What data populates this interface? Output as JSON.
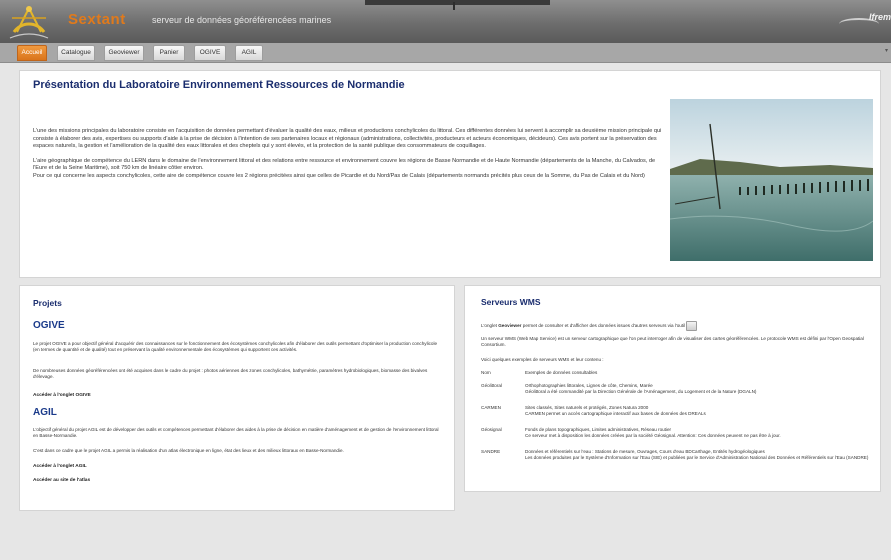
{
  "header": {
    "brand": "Sextant",
    "tagline": "serveur de données géoréférencées marines",
    "partner": "Ifrem"
  },
  "tabs": [
    {
      "label": "Accueil",
      "active": true
    },
    {
      "label": "Catalogue",
      "active": false
    },
    {
      "label": "Geoviewer",
      "active": false
    },
    {
      "label": "Panier",
      "active": false
    },
    {
      "label": "OGIVE",
      "active": false
    },
    {
      "label": "AGIL",
      "active": false
    }
  ],
  "presentation": {
    "title": "Présentation du Laboratoire Environnement Ressources de Normandie",
    "paragraphs": [
      "L'une des missions principales du laboratoire consiste en l'acquisition de données permettant d'évaluer la qualité des eaux, milieux et productions conchylicoles du littoral. Ces différentes données lui servent à accomplir sa deuxième mission principale qui consiste à élaborer des avis, expertises ou supports d'aide à la prise de décision à l'intention de ses partenaires locaux et régionaux (administrations, collectivités, producteurs et acteurs économiques, décideurs). Ces avis portent sur la préservation des espaces naturels, la gestion et l'amélioration de la qualité des eaux littorales et des cheptels qui y sont élevés, et la protection de la santé publique des consommateurs de coquillages.",
      "L'aire géographique de compétence du LERN dans le domaine de l'environnement littoral et des relations entre ressource et environnement couvre les régions de Basse Normandie et de Haute Normandie (départements de la Manche, du Calvados, de l'Eure et de la Seine Maritime), soit 750 km de linéaire côtier environ.",
      "Pour ce qui concerne les aspects conchylicoles, cette aire de compétence couvre les 2 régions précitées ainsi que celles de Picardie et du Nord/Pas de Calais (départements normands précités plus ceux de la Somme, du Pas de Calais et du Nord)"
    ]
  },
  "projets": {
    "heading": "Projets",
    "ogive": {
      "title": "OGIVE",
      "p1": "Le projet OGIVE a pour objectif général d'acquérir des connaissances sur le fonctionnement des écosystèmes conchylicoles afin d'élaborer des outils permettant d'optimiser la production conchylicole (en termes de quantité et de qualité) tout en préservant la qualité environnementale des écosystèmes qui supportent ces activités.",
      "p2": "De nombreuses données géoréférencées ont été acquises dans le cadre du projet : photos aériennes des zones conchylicoles, bathymétrie, paramètres hydrobiologiques, biomasse des bivalves d'élevage.",
      "link": "Accéder à l'onglet OGIVE"
    },
    "agil": {
      "title": "AGIL",
      "p1": "L'objectif général du projet AGIL est de développer des outils et compétences permettant d'élaborer des aides à la prise de décision en matière d'aménagement et de gestion de l'environnement littoral en Basse-Normandie.",
      "p2": "C'est dans ce cadre que le projet AGIL a permis la réalisation d'un atlas électronique en ligne, état des lieux et des milieux littoraux en Basse-Normandie.",
      "link1": "Accéder à l'onglet AGIL",
      "link2": "Accéder au site de l'atlas"
    }
  },
  "wms": {
    "heading": "Serveurs WMS",
    "intro_pre": "L'onglet",
    "intro_bold": "Geoviewer",
    "intro_post": "permet de consulter et d'afficher des données issues d'autres serveurs via l'outil",
    "definition": "Un serveur WMS (Web Map Service) est un serveur cartographique que l'on peut interroger afin de visualiser des cartes géoréférencées. Le protocole WMS est défini par l'Open Geospatial Consortium.",
    "examples_intro": "Voici quelques exemples de serveurs WMS et leur contenu :",
    "table_header": {
      "k": "Nom",
      "v": "Exemples de données consultables"
    },
    "rows": [
      {
        "k": "Géolittoral",
        "v1": "Orthophotographies littorales, Lignes de côte, Chemins, Marée",
        "v2": "Géolittoral a été commandité par la Direction Générale de l'Aménagement, du Logement et de la Nature (DGALN)"
      },
      {
        "k": "CARMEN",
        "v1": "Sites classés, Sites naturels et protégés, Zones Natura 2000",
        "v2": "CARMEN permet un accès cartographique interactif aux bases de données des DREALs"
      },
      {
        "k": "Géosignal",
        "v1": "Fonds de plans topographiques, Limites administratives, Réseau routier",
        "v2": "Ce serveur met à disposition les données créées par la société Géosignal. Attention: Ces données peuvent ne pas être à jour."
      },
      {
        "k": "SANDRE",
        "v1": "Données et référentiels sur l'eau : Stations de mesure, Ouvrages, Cours d'eau BDCarthage, Entités hydrogéologiques",
        "v2": "Les données produites par le Système d'Information sur l'Eau (SIE) et publiées par le Service d'Administration National des Données et Référentiels sur l'Eau (SANDRE)"
      }
    ]
  },
  "icons": {
    "logo": "sextant-instrument-icon",
    "geoviewer_tool": "geoviewer-tool-icon"
  },
  "colors": {
    "brand": "#e07a1c",
    "title": "#1a2d6e",
    "tab_active": "#e8852b"
  }
}
